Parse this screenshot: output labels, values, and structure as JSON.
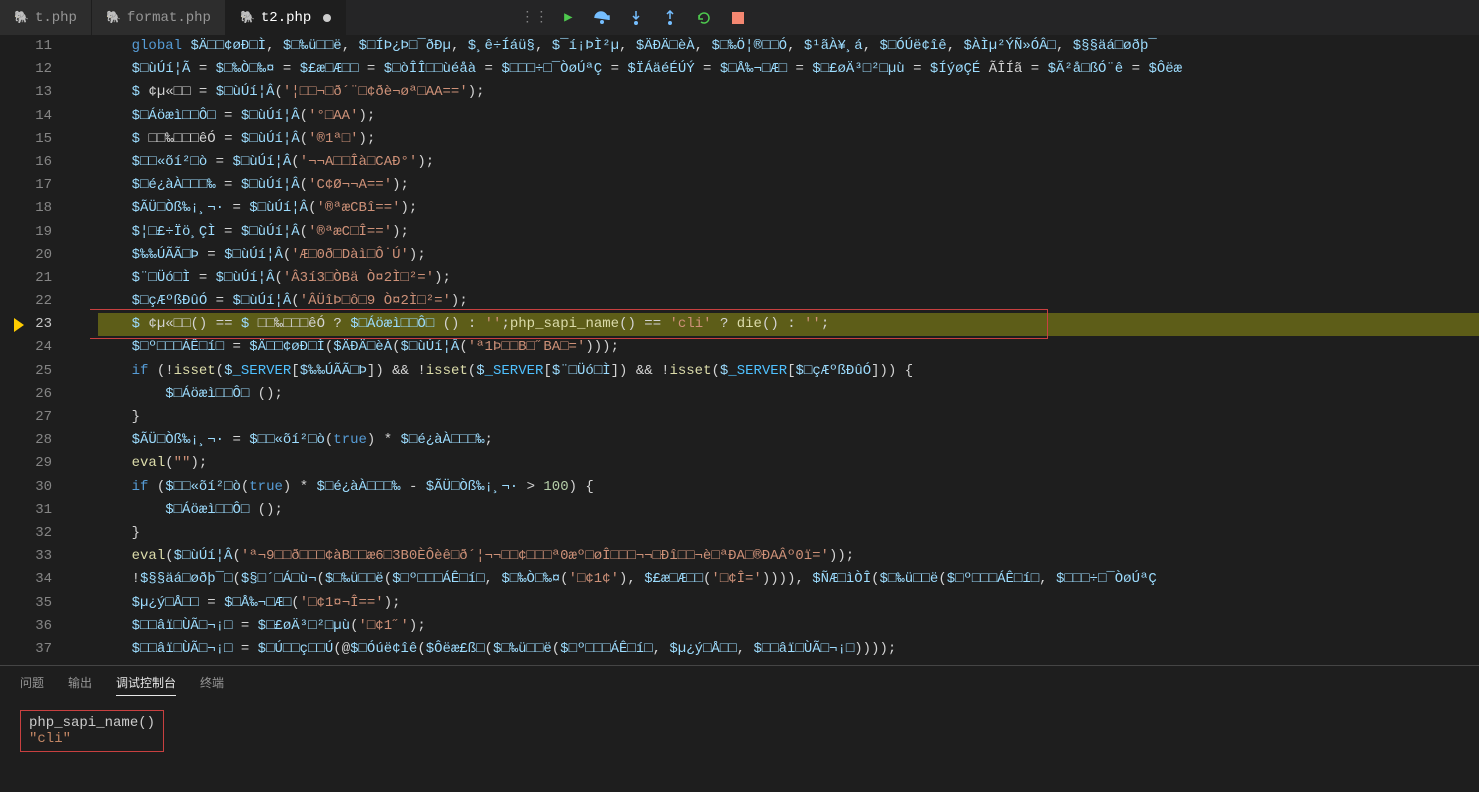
{
  "tabs": [
    {
      "label": "t.php",
      "active": false,
      "dirty": false
    },
    {
      "label": "format.php",
      "active": false,
      "dirty": false
    },
    {
      "label": "t2.php",
      "active": true,
      "dirty": true
    }
  ],
  "line_start": 11,
  "line_end": 37,
  "current_line": 23,
  "code_lines": [
    "    global $Ä□□¢øÐ□Ì, $□‰ü□□ë, $□ÍÞ¿Þ□¯ðÐµ, $¸ê÷Íáü§, $¯í¡ÞÌ²µ, $ÄÐÄ□èÀ, $□‰Ö¦®□□Ó, $¹ãÀ¥¸á, $□ÓÚë¢îê, $ÀÌµ²ÝÑ»ÓÂ□, $§§äá□øðþ¯",
    "    $□ùÚí¦Ã = $□‰Ò□‰¤ = $£æ□Æ□□ = $□òÎÎ□□ùéåà = $□□□÷□¯ÒøÚªÇ = $ÏÁäéÉÚÝ = $□Å‰¬□Æ□ = $□£øÄ³□²□µù = $ÍýøÇÉ ÃÎÍã = $Ã²å□ßÓ¨ê = $Ôëæ",
    "    $ ¢µ«□□ = $□ùÚí¦Â('¦□□¬□ð´¨□¢ðè¬øª□AA==');",
    "    $□Áöæì□□Ô□ = $□ùÚí¦Â('°□AA');",
    "    $ □□‰□□□êÓ = $□ùÚí¦Â('®1ª□');",
    "    $□□«õí²□ò = $□ùÚí¦Â('¬¬A□□Îà□CAÐ°');",
    "    $□é¿àÀ□□□‰ = $□ùÚí¦Â('C¢Ø¬¬A==');",
    "    $ÃÜ□Òß‰¡¸¬· = $□ùÚí¦Â('®ªæCBî==');",
    "    $¦□£÷Ïö¸ÇÌ = $□ùÚí¦Â('®ªæC□Î==');",
    "    $‰‰ÚÃÃ□Þ = $□ùÚí¦Â('Æ□0ð□Dàì□Ô˙Ú');",
    "    $¨□Üó□Ì = $□ùÚí¦Â('Â3í3□ÒBä Ò¤2Ì□²=');",
    "    $□çÆºßÐûÓ = $□ùÚí¦Â('ÂÜîÞ□ô□9 Ò¤2Ì□²=');",
    "    $ ¢µ«□□() == $ □□‰□□□êÓ ? $□Áöæì□□Ô□ () : '';php_sapi_name() == 'cli' ? die() : '';",
    "    $□º□□□ÁÊ□í□ = $Ä□□¢øÐ□Ì($ÄÐÄ□èÀ($□ùÚí¦Â('ª1Þ□□B□˝BA□=')));",
    "    if (!isset($_SERVER[$‰‰ÚÃÃ□Þ]) && !isset($_SERVER[$¨□Üó□Ì]) && !isset($_SERVER[$□çÆºßÐûÓ])) {",
    "        $□Áöæì□□Ô□ ();",
    "    }",
    "    $ÃÜ□Òß‰¡¸¬· = $□□«õí²□ò(true) * $□é¿àÀ□□□‰;",
    "    eval(\"\");",
    "    if ($□□«õí²□ò(true) * $□é¿àÀ□□□‰ - $ÃÜ□Òß‰¡¸¬· > 100) {",
    "        $□Áöæì□□Ô□ ();",
    "    }",
    "    eval($□ùÚí¦Â('ª¬9□□ð□□□¢àB□□æ6□3B0ÈÔèê□ð´¦¬¬□□¢□□□ª0æº□øÎ□□□¬¬□Đî□□¬è□ªÐA□®ĐAÂº0ï='));",
    "    !$§§äá□øðþ¯□($§□´□Á□ù¬($□‰ü□□ë($□º□□□ÁÊ□í□, $□‰Ò□‰¤('□¢1¢'), $£æ□Æ□□('□¢Î=')))), $ÑÆ□ìÒÎ($□‰ü□□ë($□º□□□ÁÊ□í□, $□□□÷□¯ÒøÚªÇ",
    "    $µ¿ý□Å□□ = $□Å‰¬□Æ□('□¢1¤¬Î==');",
    "    $□□âï□ÙÃ□¬¡□ = $□£øÄ³□²□µù('□¢1˝');",
    "    $□□âï□ÙÃ□¬¡□ = $□Ú□□ç□□Ú(@$□Óúë¢îê($Ôëæ£ß□($□‰ü□□ë($□º□□□ÁÊ□í□, $µ¿ý□Å□□, $□□âï□ÙÃ□¬¡□))));"
  ],
  "red_box_line_index": 12,
  "panel": {
    "tabs": [
      "问题",
      "输出",
      "调试控制台",
      "终端"
    ],
    "active_tab": 2,
    "debug_input": "php_sapi_name()",
    "debug_output": "\"cli\""
  }
}
